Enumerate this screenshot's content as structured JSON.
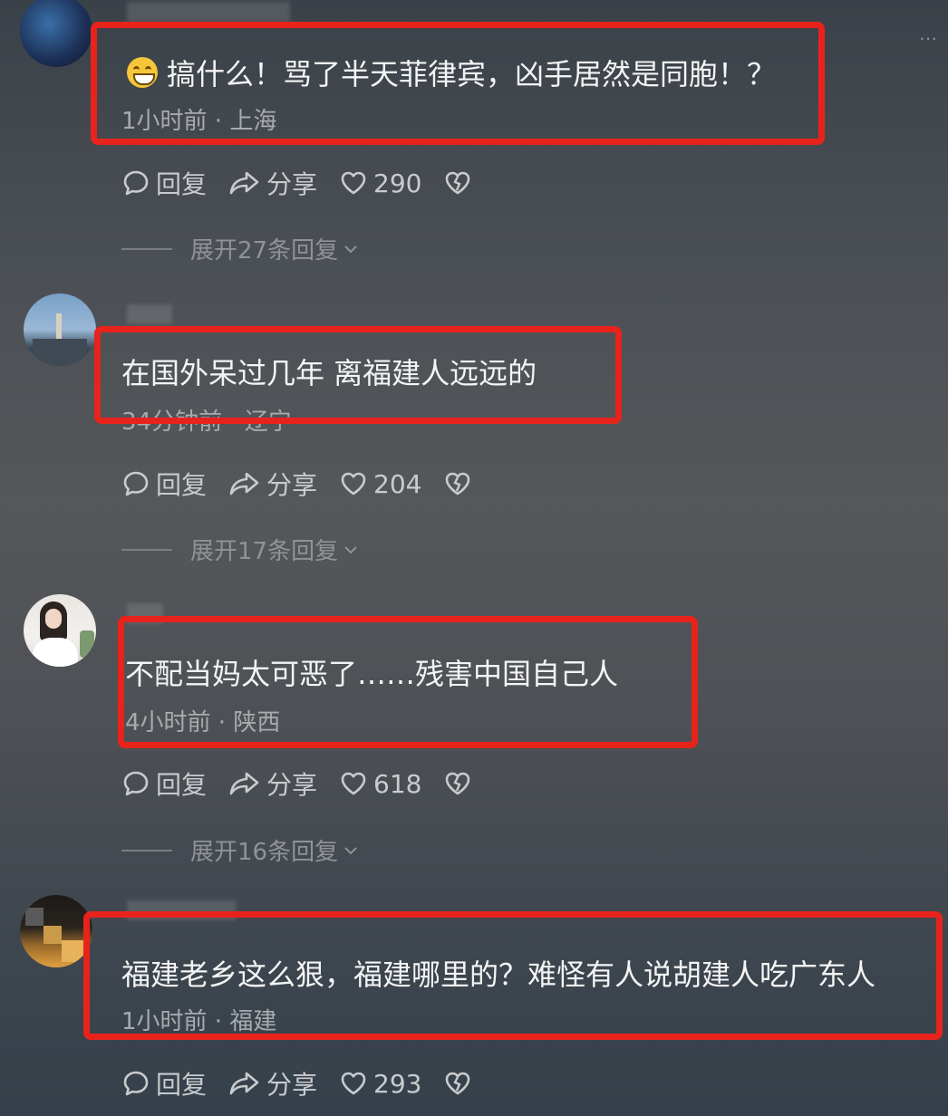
{
  "comments": [
    {
      "text": "搞什么！骂了半天菲律宾，凶手居然是同胞！？",
      "has_emoji": true,
      "meta": "1小时前 · 上海",
      "reply_label": "回复",
      "share_label": "分享",
      "likes": "290",
      "expand": "展开27条回复"
    },
    {
      "text": "在国外呆过几年 离福建人远远的",
      "has_emoji": false,
      "meta": "34分钟前 · 辽宁",
      "reply_label": "回复",
      "share_label": "分享",
      "likes": "204",
      "expand": "展开17条回复"
    },
    {
      "text": "不配当妈太可恶了……残害中国自己人",
      "has_emoji": false,
      "meta": "4小时前 · 陕西",
      "reply_label": "回复",
      "share_label": "分享",
      "likes": "618",
      "expand": "展开16条回复"
    },
    {
      "text": "福建老乡这么狠，福建哪里的？难怪有人说胡建人吃广东人",
      "has_emoji": false,
      "meta": "1小时前 · 福建",
      "reply_label": "回复",
      "share_label": "分享",
      "likes": "293"
    }
  ],
  "colors": {
    "highlight": "#e8231c",
    "meta_text": "#a8abae",
    "action_text": "#c9cbcd"
  },
  "icons": [
    "comment-icon",
    "share-icon",
    "heart-icon",
    "dislike-icon",
    "chevron-down-icon",
    "more-icon"
  ]
}
